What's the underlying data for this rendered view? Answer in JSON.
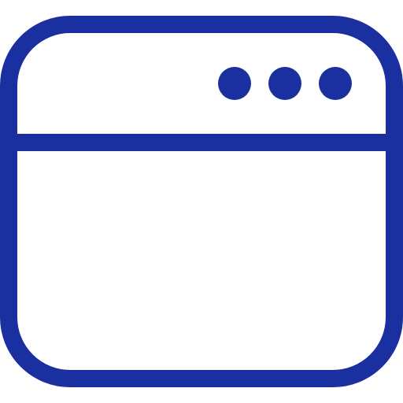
{
  "icon": {
    "name": "browser-window-icon",
    "stroke_color": "#1a2fa0",
    "background_color": "#ffffff",
    "dots": [
      "dot-1",
      "dot-2",
      "dot-3"
    ]
  }
}
